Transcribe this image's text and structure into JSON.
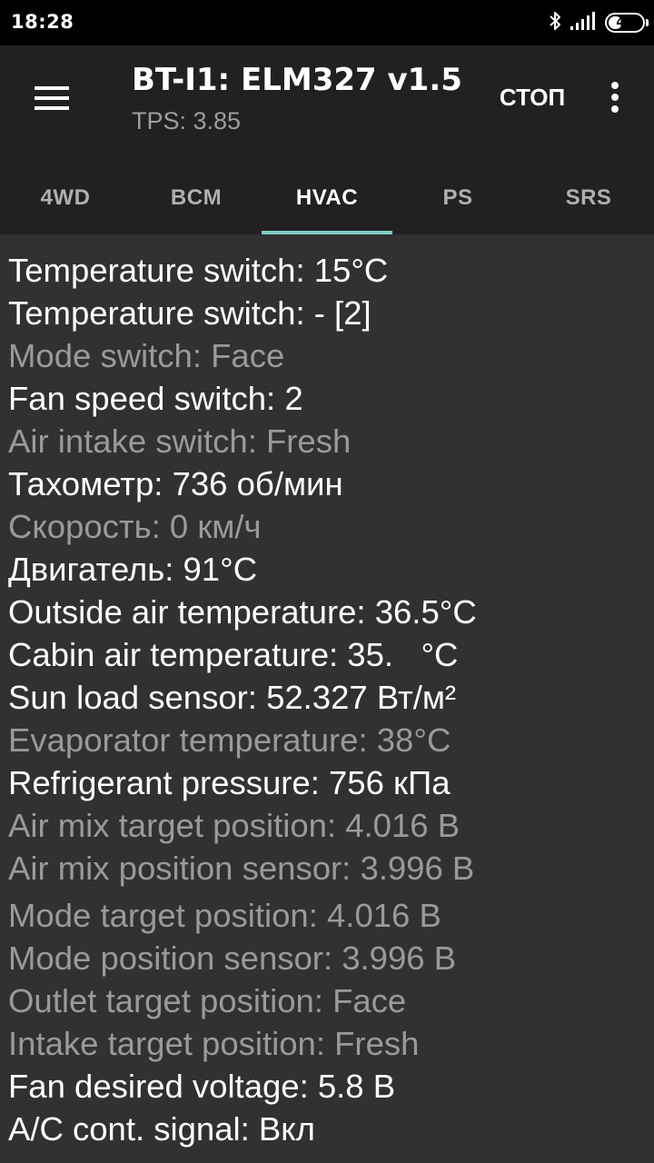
{
  "status_bar": {
    "time": "18:28",
    "battery": "42",
    "battery_level": 0.42,
    "icons": [
      "bluetooth-icon",
      "signal-icon",
      "battery-icon"
    ]
  },
  "toolbar": {
    "title": "BT-I1: ELM327 v1.5",
    "subtitle": "TPS: 3.85",
    "stop_label": "СТОП",
    "menu_icon": "hamburger-menu-icon",
    "overflow_icon": "more-vert-icon"
  },
  "tabs": [
    {
      "label": "4WD",
      "active": false
    },
    {
      "label": "BCM",
      "active": false
    },
    {
      "label": "HVAC",
      "active": true
    },
    {
      "label": "PS",
      "active": false
    },
    {
      "label": "SRS",
      "active": false
    }
  ],
  "colors": {
    "background": "#313131",
    "toolbar": "#212121",
    "tab_indicator": "#80cbc4",
    "text_active": "#ffffff",
    "text_inactive": "#9a9a9a"
  },
  "parameters": [
    {
      "text": "Temperature switch: 15°C",
      "active": true
    },
    {
      "text": "Temperature switch: - [2]",
      "active": true
    },
    {
      "text": "Mode switch: Face",
      "active": false
    },
    {
      "text": "Fan speed switch: 2",
      "active": true
    },
    {
      "text": "Air intake switch: Fresh",
      "active": false
    },
    {
      "text": "Тахометр: 736 об/мин",
      "active": true
    },
    {
      "text": "Скорость: 0 км/ч",
      "active": false
    },
    {
      "text": "Двигатель: 91°C",
      "active": true
    },
    {
      "text": "Outside air temperature: 36.5°C",
      "active": true
    },
    {
      "text": "Cabin air temperature: 35.   °C",
      "active": true
    },
    {
      "text": "Sun load sensor: 52.327 Вт/м²",
      "active": true
    },
    {
      "text": "Evaporator temperature: 38°C",
      "active": false
    },
    {
      "text": "Refrigerant pressure: 756 кПа",
      "active": true
    },
    {
      "text": "Air mix target position: 4.016 В",
      "active": false
    },
    {
      "text": "Air mix position sensor: 3.996 В",
      "active": false
    },
    {
      "text": "Mode target position: 4.016 В",
      "active": false
    },
    {
      "text": "Mode position sensor: 3.996 В",
      "active": false
    },
    {
      "text": "Outlet target position: Face",
      "active": false
    },
    {
      "text": "Intake target position: Fresh",
      "active": false
    },
    {
      "text": "Fan desired voltage: 5.8 В",
      "active": true
    },
    {
      "text": "A/C cont. signal: Вкл",
      "active": true
    }
  ]
}
